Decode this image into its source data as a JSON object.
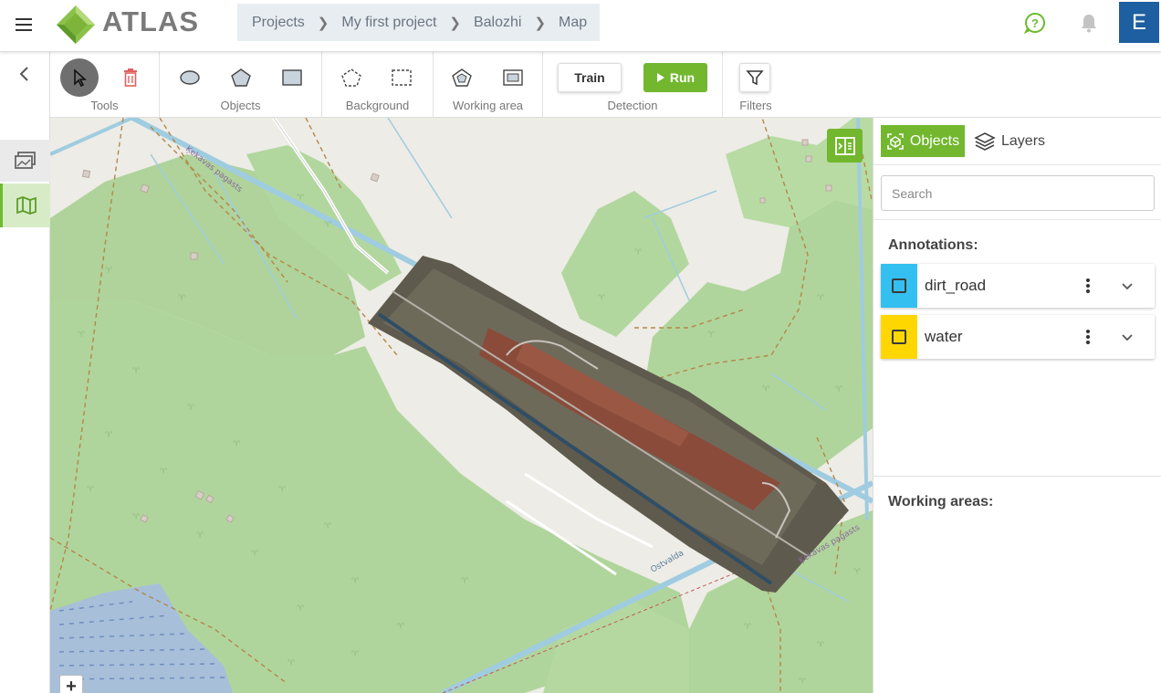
{
  "app": {
    "name": "ATLAS"
  },
  "breadcrumb": [
    {
      "label": "Projects"
    },
    {
      "label": "My first project"
    },
    {
      "label": "Balozhi"
    },
    {
      "label": "Map"
    }
  ],
  "header": {
    "user_initial": "E",
    "icons": [
      "menu-icon",
      "help-icon",
      "bell-icon"
    ]
  },
  "toolbar": {
    "groups": [
      {
        "label": "Tools",
        "icons": [
          "pointer-icon",
          "trash-icon"
        ]
      },
      {
        "label": "Objects",
        "icons": [
          "ellipse-icon",
          "polygon-icon",
          "rectangle-icon"
        ]
      },
      {
        "label": "Background",
        "icons": [
          "dashed-polygon-icon",
          "dashed-rectangle-icon"
        ]
      },
      {
        "label": "Working area",
        "icons": [
          "working-area-polygon-icon",
          "working-area-rectangle-icon"
        ]
      },
      {
        "label": "Detection",
        "train": "Train",
        "run": "Run"
      },
      {
        "label": "Filters",
        "icons": [
          "filter-icon"
        ]
      }
    ]
  },
  "map": {
    "labels": [
      "Ķekavas pagasts",
      "Ķekavas pagasts",
      "Ostvalda"
    ],
    "zoom_in": "+"
  },
  "panel": {
    "tabs": {
      "objects": "Objects",
      "layers": "Layers"
    },
    "search_placeholder": "Search",
    "annotations_title": "Annotations:",
    "annotations": [
      {
        "name": "dirt_road",
        "color": "#33c0f0"
      },
      {
        "name": "water",
        "color": "#ffd700"
      }
    ],
    "working_areas_title": "Working areas:"
  },
  "colors": {
    "accent": "#72b72e",
    "avatar": "#1d5fa0"
  }
}
